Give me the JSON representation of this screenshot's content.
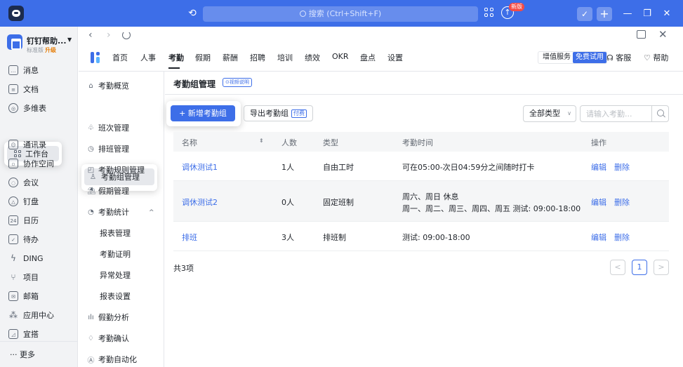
{
  "titlebar": {
    "search_placeholder": "搜索 (Ctrl+Shift+F)",
    "new_badge": "新版"
  },
  "sidebar": {
    "org_name": "钉钉帮助...",
    "org_plan": "标准版",
    "org_upgrade": "升级",
    "items": [
      {
        "label": "消息",
        "icon": "message-icon"
      },
      {
        "label": "文档",
        "icon": "document-icon"
      },
      {
        "label": "多维表",
        "icon": "multi-table-icon"
      },
      {
        "label": "工作台",
        "icon": "workbench-icon"
      },
      {
        "label": "通讯录",
        "icon": "contacts-icon"
      },
      {
        "label": "协作空间",
        "icon": "collab-space-icon"
      },
      {
        "label": "会议",
        "icon": "meeting-icon"
      },
      {
        "label": "钉盘",
        "icon": "drive-icon"
      },
      {
        "label": "日历",
        "icon": "calendar-icon"
      },
      {
        "label": "待办",
        "icon": "todo-icon"
      },
      {
        "label": "DING",
        "icon": "ding-icon"
      },
      {
        "label": "项目",
        "icon": "project-icon"
      },
      {
        "label": "邮箱",
        "icon": "mail-icon"
      },
      {
        "label": "应用中心",
        "icon": "app-center-icon"
      },
      {
        "label": "宜搭",
        "icon": "yida-icon"
      }
    ],
    "more_label": "··· 更多"
  },
  "appbar": {
    "tabs": [
      "首页",
      "人事",
      "考勤",
      "假期",
      "薪酬",
      "招聘",
      "培训",
      "绩效",
      "OKR",
      "盘点",
      "设置"
    ],
    "active_tab": "考勤",
    "vas_label": "增值服务",
    "trial_label": "免费试用",
    "service_label": "客服",
    "help_label": "帮助"
  },
  "subnav": {
    "items": [
      {
        "label": "考勤概览",
        "icon": "home-icon"
      },
      {
        "label": "考勤组管理",
        "icon": "group-icon"
      },
      {
        "label": "班次管理",
        "icon": "shift-icon"
      },
      {
        "label": "排班管理",
        "icon": "schedule-icon"
      },
      {
        "label": "考勤规则管理",
        "icon": "rules-icon"
      },
      {
        "label": "假期管理",
        "icon": "holiday-icon"
      },
      {
        "label": "考勤统计",
        "icon": "stats-icon"
      },
      {
        "label": "报表管理",
        "icon": ""
      },
      {
        "label": "考勤证明",
        "icon": ""
      },
      {
        "label": "异常处理",
        "icon": ""
      },
      {
        "label": "报表设置",
        "icon": ""
      },
      {
        "label": "假勤分析",
        "icon": "analysis-icon"
      },
      {
        "label": "考勤确认",
        "icon": "confirm-icon"
      },
      {
        "label": "考勤自动化",
        "icon": "automation-icon"
      }
    ]
  },
  "content": {
    "page_title": "考勤组管理",
    "video_link": "⊙视频说明",
    "add_button": "+ 新增考勤组",
    "export_button": "导出考勤组",
    "paid_badge": "付费",
    "type_select": "全部类型",
    "search_placeholder": "请输入考勤...",
    "columns": [
      "名称",
      "人数",
      "类型",
      "考勤时间",
      "操作"
    ],
    "rows": [
      {
        "name": "调休测试1",
        "count": "1人",
        "type": "自由工时",
        "time_lines": [
          "可在05:00-次日04:59分之间随时打卡"
        ],
        "edit": "编辑",
        "delete": "删除"
      },
      {
        "name": "调休测试2",
        "count": "0人",
        "type": "固定班制",
        "time_lines": [
          "周六、周日  休息",
          "周一、周二、周三、周四、周五  测试: 09:00-18:00"
        ],
        "edit": "编辑",
        "delete": "删除"
      },
      {
        "name": "排班",
        "count": "3人",
        "type": "排班制",
        "time_lines": [
          "测试: 09:00-18:00"
        ],
        "edit": "编辑",
        "delete": "删除"
      }
    ],
    "total": "共3项",
    "page_prev": "<",
    "page_current": "1",
    "page_next": ">"
  },
  "colors": {
    "titlebar": "#3d6ee8",
    "accent": "#3d6ee8",
    "sidebar_bg": "#f2f3f5"
  }
}
